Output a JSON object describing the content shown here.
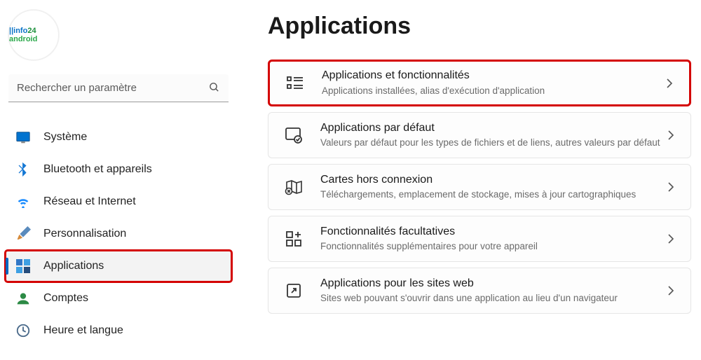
{
  "profile": {
    "label": "info24 android"
  },
  "search": {
    "placeholder": "Rechercher un paramètre"
  },
  "sidebar": {
    "items": [
      {
        "label": "Système"
      },
      {
        "label": "Bluetooth et appareils"
      },
      {
        "label": "Réseau et Internet"
      },
      {
        "label": "Personnalisation"
      },
      {
        "label": "Applications"
      },
      {
        "label": "Comptes"
      },
      {
        "label": "Heure et langue"
      }
    ]
  },
  "page": {
    "title": "Applications"
  },
  "cards": [
    {
      "title": "Applications et fonctionnalités",
      "sub": "Applications installées, alias d'exécution d'application"
    },
    {
      "title": "Applications par défaut",
      "sub": "Valeurs par défaut pour les types de fichiers et de liens, autres valeurs par défaut"
    },
    {
      "title": "Cartes hors connexion",
      "sub": "Téléchargements, emplacement de stockage, mises à jour cartographiques"
    },
    {
      "title": "Fonctionnalités facultatives",
      "sub": "Fonctionnalités supplémentaires pour votre appareil"
    },
    {
      "title": "Applications pour les sites web",
      "sub": "Sites web pouvant s'ouvrir dans une application au lieu d'un navigateur"
    }
  ]
}
